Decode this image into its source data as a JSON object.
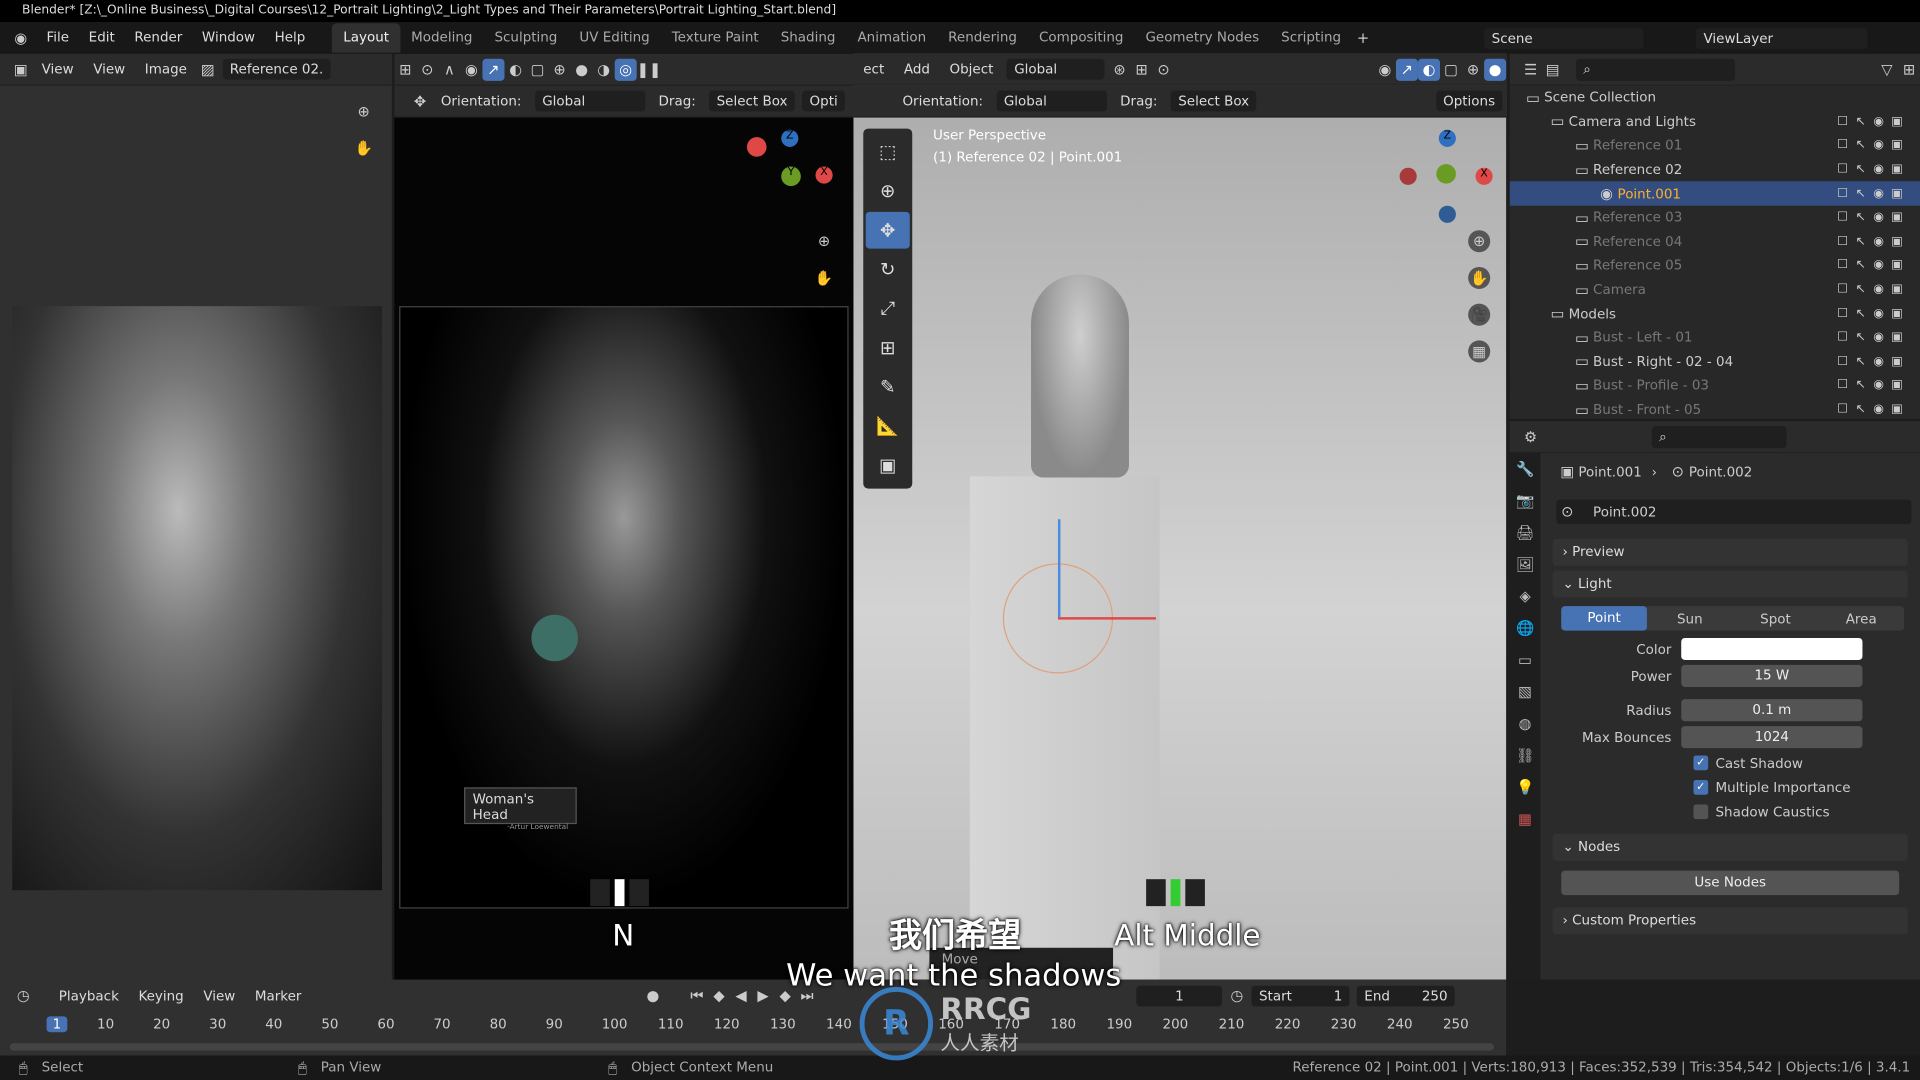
{
  "titlebar": {
    "title": "Blender* [Z:\\_Online Business\\_Digital Courses\\12_Portrait Lighting\\2_Light Types and Their Parameters\\Portrait Lighting_Start.blend]"
  },
  "menu": [
    "File",
    "Edit",
    "Render",
    "Window",
    "Help"
  ],
  "workspaces": [
    "Layout",
    "Modeling",
    "Sculpting",
    "UV Editing",
    "Texture Paint",
    "Shading",
    "Animation",
    "Rendering",
    "Compositing",
    "Geometry Nodes",
    "Scripting"
  ],
  "scene": "Scene",
  "view_layer": "ViewLayer",
  "image_editor": {
    "view": "View",
    "view2": "View",
    "image": "Image",
    "image_name": "Reference 02."
  },
  "mid_viewport": {
    "orientation_label": "Orientation:",
    "orientation": "Global",
    "drag_label": "Drag:",
    "drag": "Select Box",
    "options": "Opti",
    "plaque_title": "Woman's Head",
    "plaque_sub": "-Artur Loewental"
  },
  "right_viewport": {
    "menu": [
      "ect",
      "Add",
      "Object"
    ],
    "transform": "Global",
    "orientation_label": "Orientation:",
    "orientation": "Global",
    "drag_label": "Drag:",
    "drag": "Select Box",
    "options": "Options",
    "perspective": "User Perspective",
    "context": "(1) Reference 02 | Point.001",
    "move_panel": "Move"
  },
  "outliner": {
    "items": [
      {
        "label": "Scene Collection",
        "depth": 0,
        "state": "normal"
      },
      {
        "label": "Camera and Lights",
        "depth": 1,
        "state": "normal"
      },
      {
        "label": "Reference 01",
        "depth": 2,
        "state": "dim"
      },
      {
        "label": "Reference 02",
        "depth": 2,
        "state": "normal"
      },
      {
        "label": "Point.001",
        "depth": 3,
        "state": "selected"
      },
      {
        "label": "Reference 03",
        "depth": 2,
        "state": "dim"
      },
      {
        "label": "Reference 04",
        "depth": 2,
        "state": "dim"
      },
      {
        "label": "Reference 05",
        "depth": 2,
        "state": "dim"
      },
      {
        "label": "Camera",
        "depth": 2,
        "state": "dim"
      },
      {
        "label": "Models",
        "depth": 1,
        "state": "normal"
      },
      {
        "label": "Bust - Left - 01",
        "depth": 2,
        "state": "dim"
      },
      {
        "label": "Bust - Right - 02 - 04",
        "depth": 2,
        "state": "normal"
      },
      {
        "label": "Bust - Profile - 03",
        "depth": 2,
        "state": "dim"
      },
      {
        "label": "Bust - Front - 05",
        "depth": 2,
        "state": "dim"
      }
    ]
  },
  "properties": {
    "breadcrumb_object": "Point.001",
    "breadcrumb_data": "Point.002",
    "datablock": "Point.002",
    "preview": "Preview",
    "light": "Light",
    "light_types": [
      "Point",
      "Sun",
      "Spot",
      "Area"
    ],
    "active_type": "Point",
    "fields": [
      {
        "label": "Color",
        "value": ""
      },
      {
        "label": "Power",
        "value": "15 W"
      },
      {
        "label": "Radius",
        "value": "0.1 m"
      },
      {
        "label": "Max Bounces",
        "value": "1024"
      }
    ],
    "checks": [
      {
        "label": "Cast Shadow",
        "checked": true
      },
      {
        "label": "Multiple Importance",
        "checked": true
      },
      {
        "label": "Shadow Caustics",
        "checked": false
      }
    ],
    "nodes": "Nodes",
    "use_nodes": "Use Nodes",
    "custom": "Custom Properties"
  },
  "timeline": {
    "menu": [
      "Playback",
      "Keying",
      "View",
      "Marker"
    ],
    "current": "1",
    "start_label": "Start",
    "start": "1",
    "end_label": "End",
    "end": "250",
    "ticks": [
      "1",
      "10",
      "20",
      "30",
      "40",
      "50",
      "60",
      "70",
      "80",
      "90",
      "100",
      "110",
      "120",
      "130",
      "140",
      "150",
      "160",
      "170",
      "180",
      "190",
      "200",
      "210",
      "220",
      "230",
      "240",
      "250"
    ]
  },
  "statusbar": {
    "select": "Select",
    "pan": "Pan View",
    "context": "Object Context Menu",
    "stats": "Reference 02 | Point.001 | Verts:180,913 | Faces:352,539 | Tris:354,542 | Objects:1/6 | 3.4.1"
  },
  "overlay": {
    "subtitle_cn": "我们希望",
    "subtitle_en": "We want the shadows",
    "key_left": "N",
    "key_right": "Alt Middle",
    "watermark": "RRCG",
    "watermark_cn": "人人素材"
  },
  "colors": {
    "accent": "#4772b3",
    "selected_row": "#334d80"
  }
}
